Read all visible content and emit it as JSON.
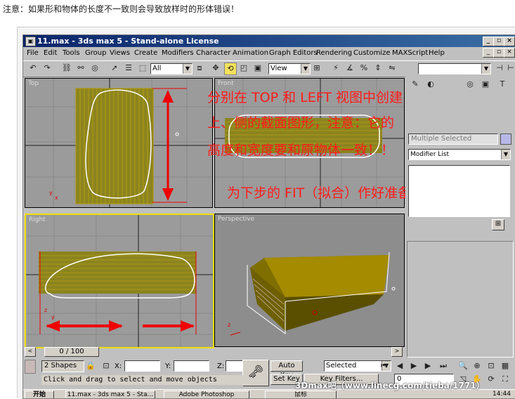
{
  "note": "注意：如果形和物体的长度不一致则会导致放样时的形体错误！",
  "window": {
    "title": "11.max - 3ds max 5 - Stand-alone License",
    "icon": "3ds-max-icon"
  },
  "menu": [
    "File",
    "Edit",
    "Tools",
    "Group",
    "Views",
    "Create",
    "Modifiers",
    "Character",
    "Animation",
    "Graph Editors",
    "Rendering",
    "Customize",
    "MAXScript",
    "Help"
  ],
  "toolbar": {
    "selection_filter": "All",
    "ref_coord": "View"
  },
  "viewports": {
    "top": "Top",
    "front": "Front",
    "right": "Right",
    "perspective": "Perspective"
  },
  "annotation": {
    "line1": "分别在 TOP 和 LEFT 视图中创建",
    "line2": "上、侧的截面图形，注意：它的",
    "line3": "高度和宽度要和原物体一致！！",
    "line4": "为下步的 FIT（拟合）作好准备！"
  },
  "command_panel": {
    "selection": "Multiple Selected",
    "modifier_list": "Modifier List"
  },
  "timeline": {
    "frame": "0 / 100"
  },
  "status": {
    "shapes": "2 Shapes",
    "x_label": "X:",
    "y_label": "Y:",
    "z_label": "Z:",
    "auto_key": "Auto Key",
    "set_key": "Set Key",
    "key_filters": "Key Filters...",
    "selected": "Selected",
    "prompt": "Click and drag to select and move objects",
    "frame_field": "0"
  },
  "taskbar": {
    "start": "开始",
    "t1": "11.max - 3ds max 5 - Sta...",
    "t2": "Adobe Photoshop",
    "t3": "鼠标",
    "time": "14:44"
  },
  "watermark": "3Dmax吧（www.linecg.com/tieba/1771）",
  "colors": {
    "accent_red": "#ff1a1a",
    "title_blue": "#0a246a",
    "mesh_gold": "#a08a00"
  }
}
